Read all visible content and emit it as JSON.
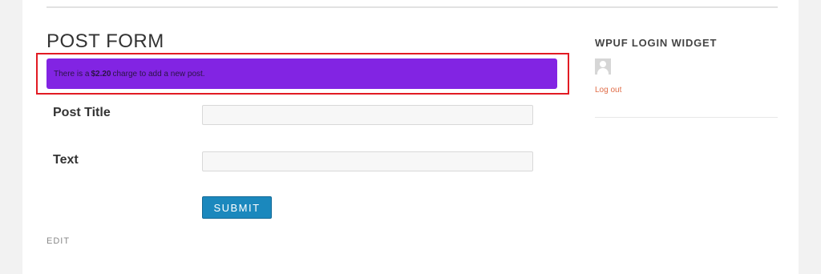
{
  "page": {
    "title": "POST FORM",
    "edit_label": "EDIT"
  },
  "notice": {
    "text_before": "There is a",
    "amount": "$2.20",
    "text_after": "charge to add a new post."
  },
  "form": {
    "fields": [
      {
        "label": "Post Title",
        "value": ""
      },
      {
        "label": "Text",
        "value": ""
      }
    ],
    "submit_label": "SUBMIT"
  },
  "sidebar": {
    "widget_title": "WPUF LOGIN WIDGET",
    "logout_label": "Log out"
  },
  "colors": {
    "notice_bg": "#8224e3",
    "highlight_border": "#e21b23",
    "submit_bg": "#1b88bd",
    "link": "#e06d48"
  }
}
